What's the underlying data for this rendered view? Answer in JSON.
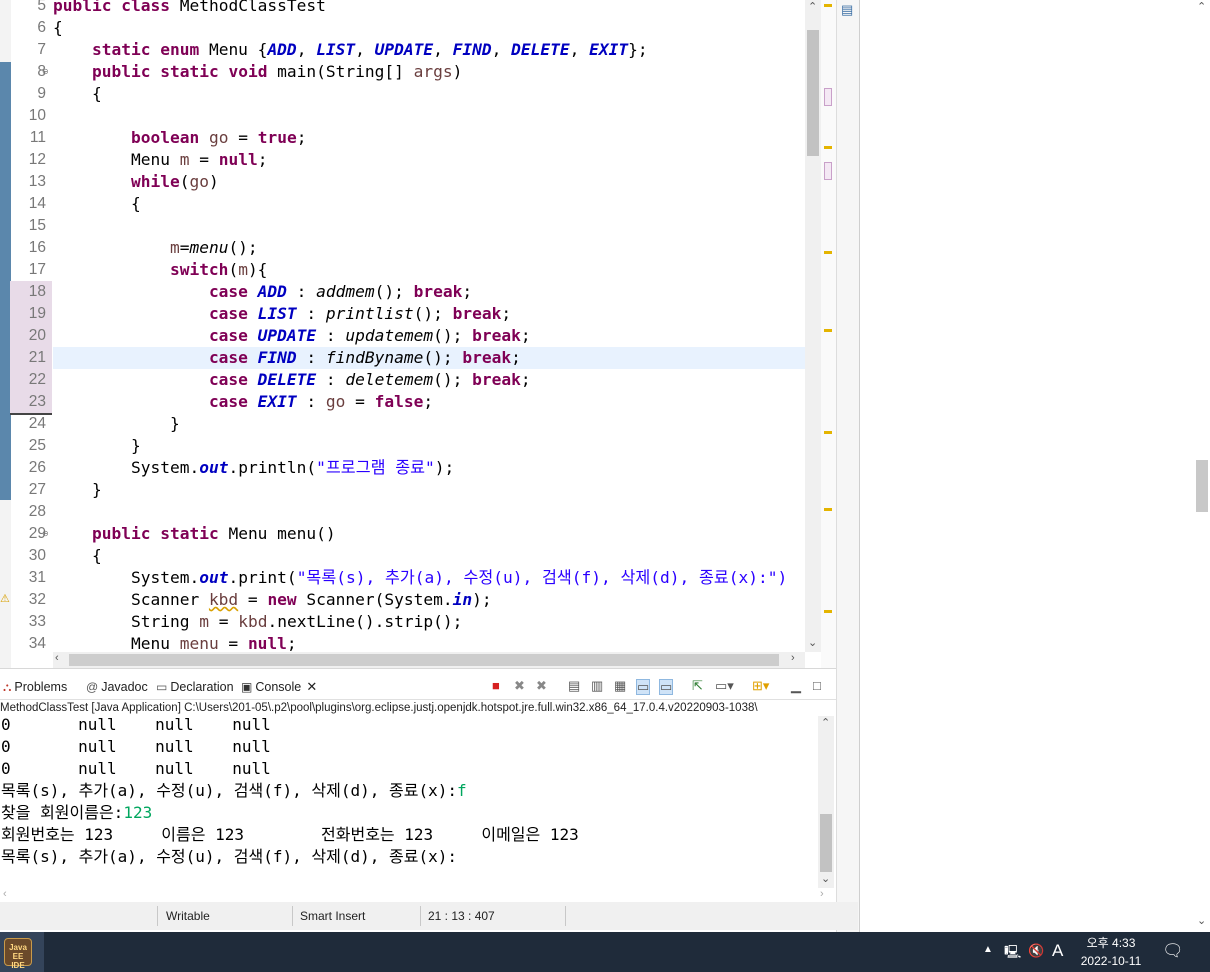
{
  "editor": {
    "line_numbers": [
      "5",
      "6",
      "7",
      "8",
      "9",
      "10",
      "11",
      "12",
      "13",
      "14",
      "15",
      "16",
      "17",
      "18",
      "19",
      "20",
      "21",
      "22",
      "23",
      "24",
      "25",
      "26",
      "27",
      "28",
      "29",
      "30",
      "31",
      "32",
      "33",
      "34"
    ],
    "code": {
      "l5": {
        "a": "public",
        "b": " ",
        "c": "class",
        "d": " MethodClassTest"
      },
      "l6": "{",
      "l7": {
        "indent": "    ",
        "k1": "static",
        "s1": " ",
        "k2": "enum",
        "t1": " Menu {",
        "e1": "ADD",
        "c1": ", ",
        "e2": "LIST",
        "c2": ", ",
        "e3": "UPDATE",
        "c3": ", ",
        "e4": "FIND",
        "c4": ", ",
        "e5": "DELETE",
        "c5": ", ",
        "e6": "EXIT",
        "t2": "};"
      },
      "l8": {
        "indent": "    ",
        "k1": "public",
        "s1": " ",
        "k2": "static",
        "s2": " ",
        "k3": "void",
        "t1": " main(String[] ",
        "v1": "args",
        "t2": ")"
      },
      "l9": "    {",
      "l11": {
        "indent": "        ",
        "k1": "boolean",
        "s1": " ",
        "v1": "go",
        "t1": " = ",
        "k2": "true",
        "t2": ";"
      },
      "l12": {
        "indent": "        ",
        "t1": "Menu ",
        "v1": "m",
        "t2": " = ",
        "k1": "null",
        "t3": ";"
      },
      "l13": {
        "indent": "        ",
        "k1": "while",
        "t1": "(",
        "v1": "go",
        "t2": ")"
      },
      "l14": "        {",
      "l16": {
        "indent": "            ",
        "v1": "m",
        "t1": "=",
        "i1": "menu",
        "t2": "();"
      },
      "l17": {
        "indent": "            ",
        "k1": "switch",
        "t1": "(",
        "v1": "m",
        "t2": "){"
      },
      "l18": {
        "indent": "                ",
        "k1": "case",
        "s1": " ",
        "e1": "ADD",
        "t1": " : ",
        "i1": "addmem",
        "t2": "(); ",
        "k2": "break",
        "t3": ";"
      },
      "l19": {
        "indent": "                ",
        "k1": "case",
        "s1": " ",
        "e1": "LIST",
        "t1": " : ",
        "i1": "printlist",
        "t2": "(); ",
        "k2": "break",
        "t3": ";"
      },
      "l20": {
        "indent": "                ",
        "k1": "case",
        "s1": " ",
        "e1": "UPDATE",
        "t1": " : ",
        "i1": "updatemem",
        "t2": "(); ",
        "k2": "break",
        "t3": ";"
      },
      "l21": {
        "indent": "                ",
        "k1": "case",
        "s1": " ",
        "e1": "FIND",
        "t1": " : ",
        "i1": "findByname",
        "t2": "(); ",
        "k2": "break",
        "t3": ";"
      },
      "l22": {
        "indent": "                ",
        "k1": "case",
        "s1": " ",
        "e1": "DELETE",
        "t1": " : ",
        "i1": "deletemem",
        "t2": "(); ",
        "k2": "break",
        "t3": ";"
      },
      "l23": {
        "indent": "                ",
        "k1": "case",
        "s1": " ",
        "e1": "EXIT",
        "t1": " : ",
        "v1": "go",
        "t2": " = ",
        "k2": "false",
        "t3": ";"
      },
      "l24": "            }",
      "l25": "        }",
      "l26": {
        "indent": "        ",
        "t1": "System.",
        "f1": "out",
        "t2": ".println(",
        "s1": "\"프로그램 종료\"",
        "t3": ");"
      },
      "l27": "    }",
      "l29": {
        "indent": "    ",
        "k1": "public",
        "s1": " ",
        "k2": "static",
        "t1": " Menu menu()"
      },
      "l30": "    {",
      "l31": {
        "indent": "        ",
        "t1": "System.",
        "f1": "out",
        "t2": ".print(",
        "s1": "\"목록(s), 추가(a), 수정(u), 검색(f), 삭제(d), 종료(x):\")"
      },
      "l32": {
        "indent": "        ",
        "t1": "Scanner ",
        "v1": "kbd",
        "t2": " = ",
        "k1": "new",
        "t3": " Scanner(System.",
        "f1": "in",
        "t4": ");"
      },
      "l33": {
        "indent": "        ",
        "t1": "String ",
        "v1": "m",
        "t2": " = ",
        "v2": "kbd",
        "t3": ".nextLine().strip();"
      },
      "l34": {
        "indent": "        ",
        "t1": "Menu ",
        "v1": "menu",
        "t2": " = ",
        "k1": "null",
        "t3": ";"
      }
    }
  },
  "views": {
    "tabs": [
      {
        "label": "Problems",
        "icon": "problems-icon"
      },
      {
        "label": "Javadoc",
        "icon": "javadoc-icon"
      },
      {
        "label": "Declaration",
        "icon": "declaration-icon"
      },
      {
        "label": "Console",
        "icon": "console-icon"
      }
    ],
    "console_title": "MethodClassTest [Java Application] C:\\Users\\201-05\\.p2\\pool\\plugins\\org.eclipse.justj.openjdk.hotspot.jre.full.win32.x86_64_17.0.4.v20220903-1038\\",
    "output": [
      "0       null    null    null",
      "0       null    null    null",
      "0       null    null    null"
    ],
    "prompt1": "목록(s), 추가(a), 수정(u), 검색(f), 삭제(d), 종료(x):",
    "input1": "f",
    "prompt2": "찾을 회원이름은:",
    "input2": "123",
    "result": "회원번호는 123     이름은 123        전화번호는 123     이메일은 123",
    "prompt3": "목록(s), 추가(a), 수정(u), 검색(f), 삭제(d), 종료(x):"
  },
  "status": {
    "writable": "Writable",
    "insert_mode": "Smart Insert",
    "position": "21 : 13 : 407"
  },
  "taskbar": {
    "app_label": "Java EE IDE",
    "ime": "A",
    "time": "오후 4:33",
    "date": "2022-10-11"
  },
  "colors": {
    "keyword": "#7f0055",
    "enum_constant": "#0000c0",
    "string": "#2a00ff",
    "local_var": "#6a3e3e",
    "console_input": "#00a65e",
    "current_line": "#e8f2fe",
    "taskbar": "#1f2b3a"
  }
}
